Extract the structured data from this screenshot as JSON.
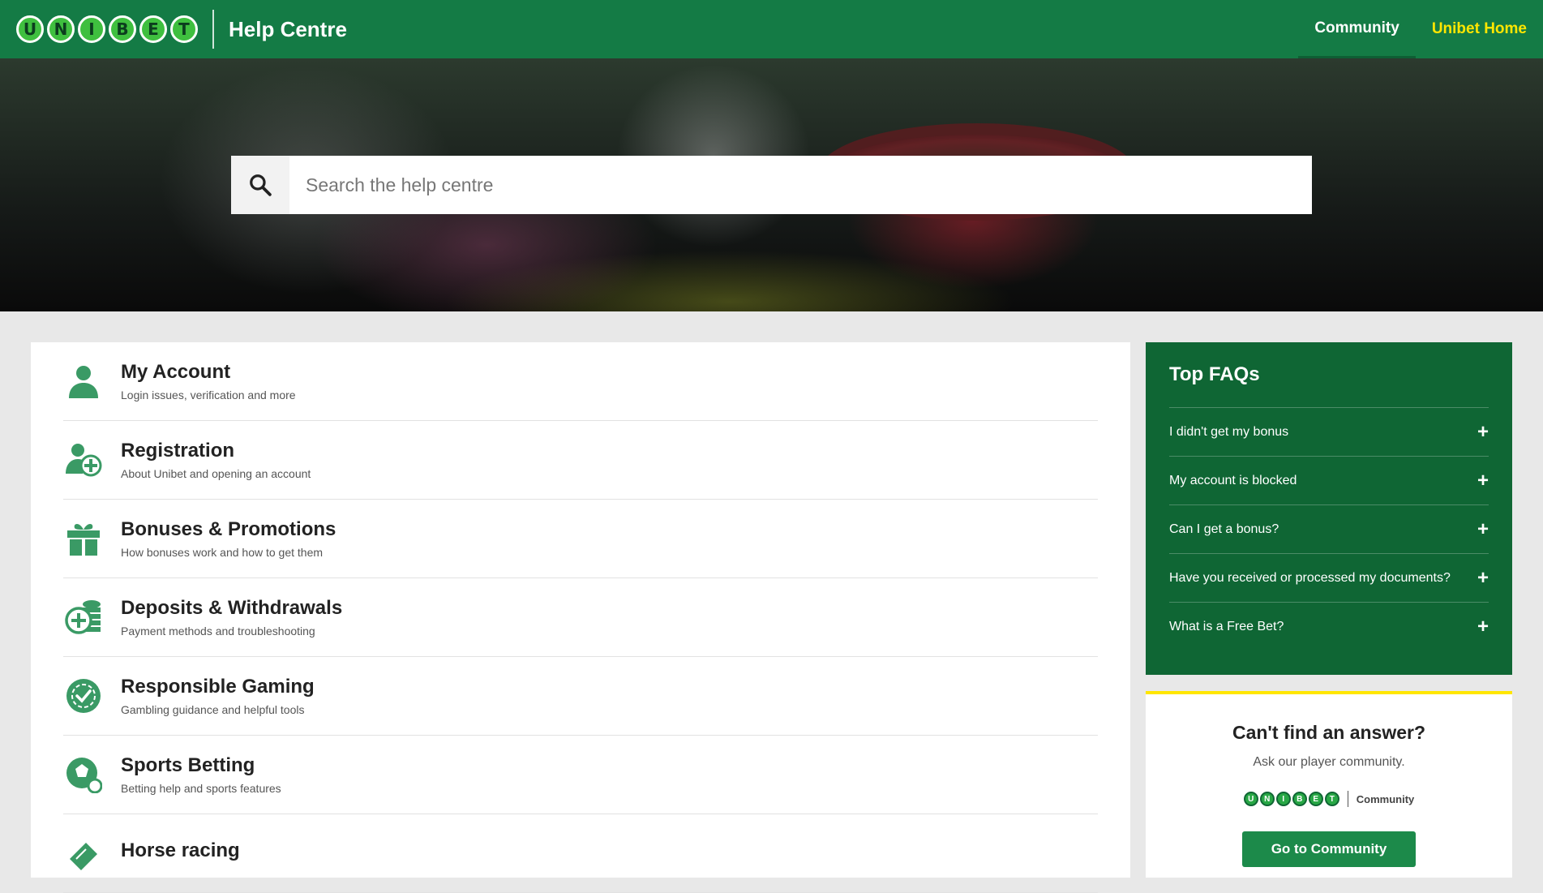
{
  "header": {
    "logo_letters": [
      "U",
      "N",
      "I",
      "B",
      "E",
      "T"
    ],
    "title": "Help Centre",
    "nav": {
      "community": "Community",
      "home": "Unibet Home"
    }
  },
  "search": {
    "placeholder": "Search the help centre",
    "value": ""
  },
  "categories": [
    {
      "title": "My Account",
      "subtitle": "Login issues, verification and more",
      "icon": "person-icon"
    },
    {
      "title": "Registration",
      "subtitle": "About Unibet and opening an account",
      "icon": "person-add-icon"
    },
    {
      "title": "Bonuses & Promotions",
      "subtitle": "How bonuses work and how to get them",
      "icon": "gift-icon"
    },
    {
      "title": "Deposits & Withdrawals",
      "subtitle": "Payment methods and troubleshooting",
      "icon": "coins-icon"
    },
    {
      "title": "Responsible Gaming",
      "subtitle": "Gambling guidance and helpful tools",
      "icon": "check-chip-icon"
    },
    {
      "title": "Sports Betting",
      "subtitle": "Betting help and sports features",
      "icon": "sports-ball-icon"
    },
    {
      "title": "Horse racing",
      "subtitle": "",
      "icon": "horse-ticket-icon"
    }
  ],
  "faqs": {
    "title": "Top FAQs",
    "items": [
      "I didn't get my bonus",
      "My account is blocked",
      "Can I get a bonus?",
      "Have you received or processed my documents?",
      "What is a Free Bet?"
    ]
  },
  "community_card": {
    "title": "Can't find an answer?",
    "subtitle": "Ask our player community.",
    "logo_label": "Community",
    "button": "Go to Community"
  },
  "colors": {
    "brand_green": "#147b45",
    "faq_green": "#0f6634",
    "accent_yellow": "#ffe600",
    "icon_green": "#3a9a65"
  }
}
